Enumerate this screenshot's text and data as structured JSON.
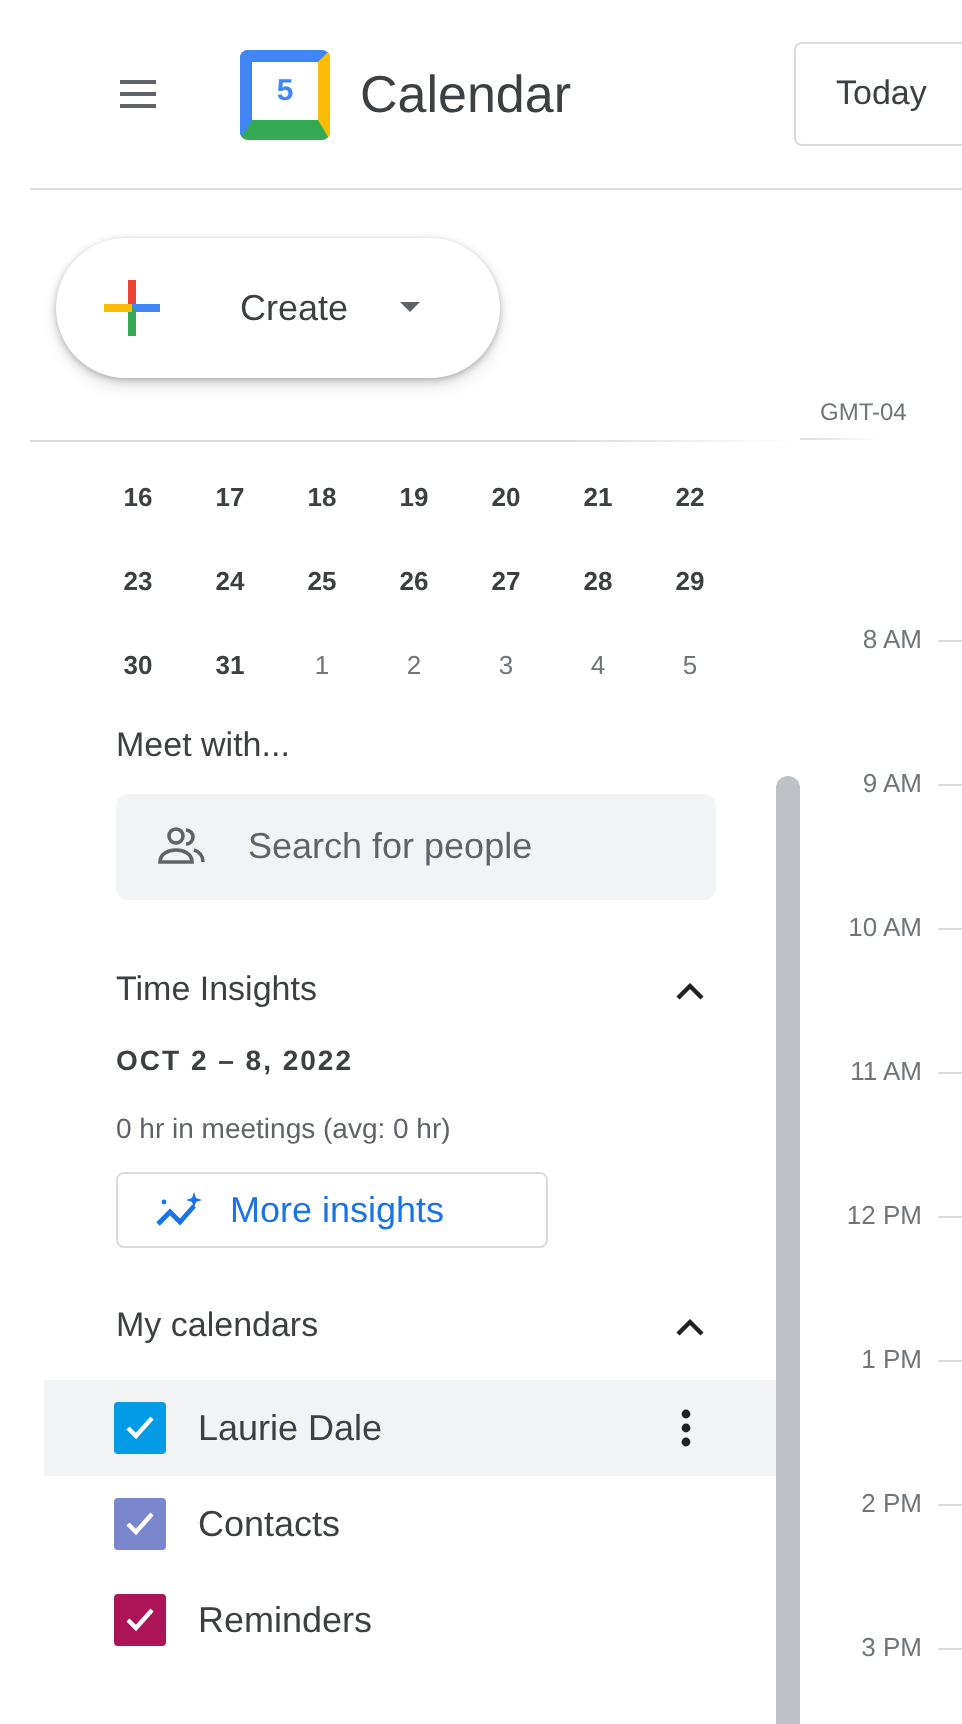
{
  "header": {
    "app_name": "Calendar",
    "logo_day": "5",
    "today_button": "Today"
  },
  "create_button": {
    "label": "Create"
  },
  "timezone": "GMT-04",
  "mini_calendar": {
    "weeks": [
      [
        {
          "day": "16",
          "in_month": true
        },
        {
          "day": "17",
          "in_month": true
        },
        {
          "day": "18",
          "in_month": true
        },
        {
          "day": "19",
          "in_month": true
        },
        {
          "day": "20",
          "in_month": true
        },
        {
          "day": "21",
          "in_month": true
        },
        {
          "day": "22",
          "in_month": true
        }
      ],
      [
        {
          "day": "23",
          "in_month": true
        },
        {
          "day": "24",
          "in_month": true
        },
        {
          "day": "25",
          "in_month": true
        },
        {
          "day": "26",
          "in_month": true
        },
        {
          "day": "27",
          "in_month": true
        },
        {
          "day": "28",
          "in_month": true
        },
        {
          "day": "29",
          "in_month": true
        }
      ],
      [
        {
          "day": "30",
          "in_month": true
        },
        {
          "day": "31",
          "in_month": true
        },
        {
          "day": "1",
          "in_month": false
        },
        {
          "day": "2",
          "in_month": false
        },
        {
          "day": "3",
          "in_month": false
        },
        {
          "day": "4",
          "in_month": false
        },
        {
          "day": "5",
          "in_month": false
        }
      ]
    ]
  },
  "meet_with": {
    "title": "Meet with...",
    "placeholder": "Search for people"
  },
  "time_insights": {
    "title": "Time Insights",
    "expanded": true,
    "date_range": "OCT 2 – 8, 2022",
    "summary": "0 hr in meetings (avg: 0 hr)",
    "button": "More insights"
  },
  "my_calendars": {
    "title": "My calendars",
    "expanded": true,
    "items": [
      {
        "name": "Laurie Dale",
        "checked": true,
        "color": "#039be5",
        "selected": true
      },
      {
        "name": "Contacts",
        "checked": true,
        "color": "#7986cb",
        "selected": false
      },
      {
        "name": "Reminders",
        "checked": true,
        "color": "#ad1457",
        "selected": false
      }
    ]
  },
  "hours": [
    "8 AM",
    "9 AM",
    "10 AM",
    "11 AM",
    "12 PM",
    "1 PM",
    "2 PM",
    "3 PM"
  ]
}
